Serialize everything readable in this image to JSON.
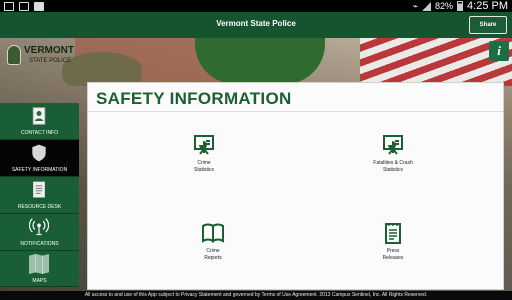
{
  "status_bar": {
    "battery": "82%",
    "time": "4:25 PM",
    "icons": [
      "mail-icon",
      "briefcase-icon",
      "store-icon",
      "wifi-icon",
      "signal-icon",
      "battery-icon"
    ]
  },
  "header": {
    "title": "Vermont State Police",
    "share_label": "Share",
    "info_icon": "info-icon"
  },
  "logo": {
    "line1": "VERMONT",
    "line2": "STATE POLICE"
  },
  "sidebar": {
    "items": [
      {
        "label": "CONTACT INFO",
        "icon": "contact-card-icon",
        "active": false
      },
      {
        "label": "SAFETY INFORMATION",
        "icon": "shield-icon",
        "active": true
      },
      {
        "label": "RESOURCE DESK",
        "icon": "document-icon",
        "active": false
      },
      {
        "label": "NOTIFICATIONS",
        "icon": "broadcast-icon",
        "active": false
      },
      {
        "label": "MAPS",
        "icon": "map-icon",
        "active": false
      }
    ]
  },
  "main": {
    "title": "SAFETY INFORMATION",
    "tiles": [
      {
        "label": "Crime\nStatistics",
        "icon": "presentation-chart-icon"
      },
      {
        "label": "Fatalities & Crash\nStatistics",
        "icon": "presentation-chart-icon"
      },
      {
        "label": "Crime\nReports",
        "icon": "book-icon"
      },
      {
        "label": "Press\nReleases",
        "icon": "notepad-icon"
      }
    ]
  },
  "footer": {
    "legal": "All access to and use of this App subject to Privacy Statement and governed by Terms of Use Agreement. 2013 Campus Sentinel, Inc. All Rights Reserved."
  },
  "colors": {
    "brand_green": "#16532f",
    "sidebar_green": "#1a5e35",
    "active_black": "#050505"
  }
}
